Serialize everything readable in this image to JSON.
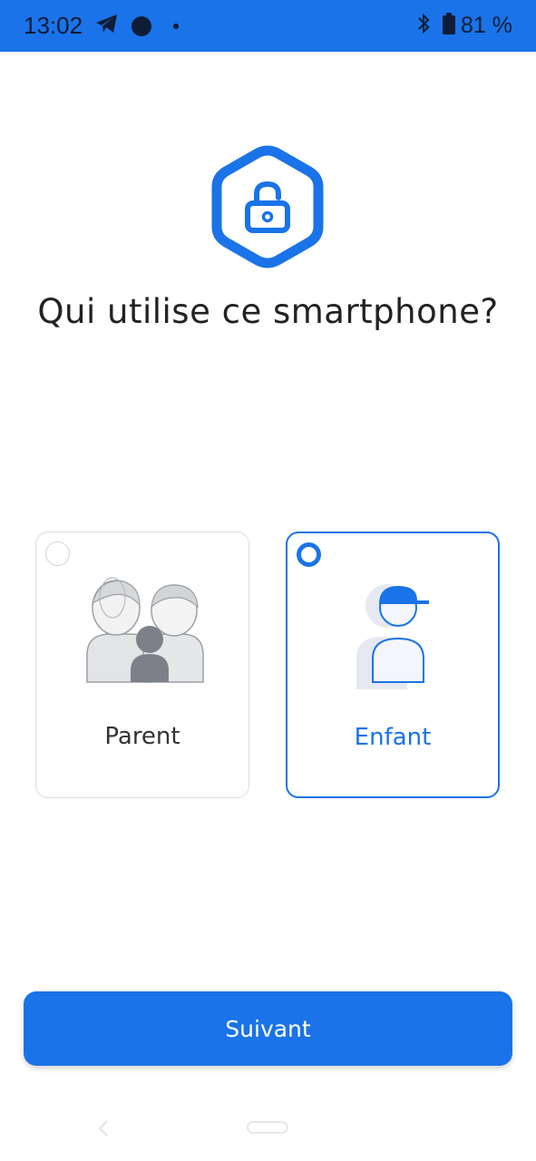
{
  "status_bar": {
    "time": "13:02",
    "battery": "81 %",
    "icons": [
      "telegram-icon",
      "notification-dot-icon",
      "small-dot-icon",
      "bluetooth-icon",
      "battery-icon"
    ]
  },
  "logo": {
    "icon": "lock-hexagon-icon"
  },
  "title": "Qui utilise ce smartphone?",
  "options": [
    {
      "label": "Parent",
      "selected": false,
      "icon": "parents-illustration"
    },
    {
      "label": "Enfant",
      "selected": true,
      "icon": "child-illustration"
    }
  ],
  "next_button": {
    "label": "Suivant"
  },
  "nav": {
    "icons": [
      "back-icon",
      "home-pill-icon"
    ]
  },
  "colors": {
    "accent": "#1a73e8",
    "text": "#222222",
    "border": "#d8dde3"
  }
}
